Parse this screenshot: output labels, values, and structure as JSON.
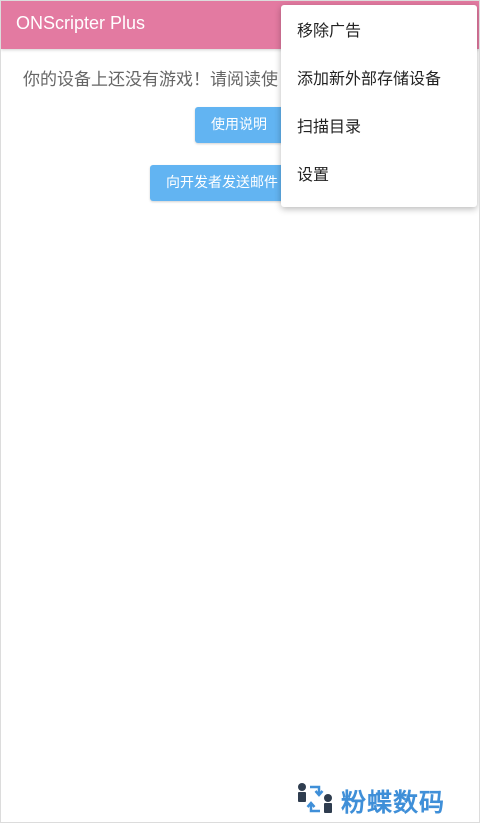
{
  "app_bar": {
    "title": "ONScripter Plus",
    "background_color": "#e37aa1"
  },
  "main": {
    "empty_message": "你的设备上还没有游戏！请阅读使",
    "usage_button_label": "使用说明",
    "email_button_label": "向开发者发送邮件",
    "button_color": "#62b4f2"
  },
  "overflow_menu": {
    "items": [
      {
        "label": "移除广告"
      },
      {
        "label": "添加新外部存储设备"
      },
      {
        "label": "扫描目录"
      },
      {
        "label": "设置"
      }
    ]
  },
  "watermark": {
    "text": "粉蝶数码",
    "color": "#3f8fd8"
  }
}
